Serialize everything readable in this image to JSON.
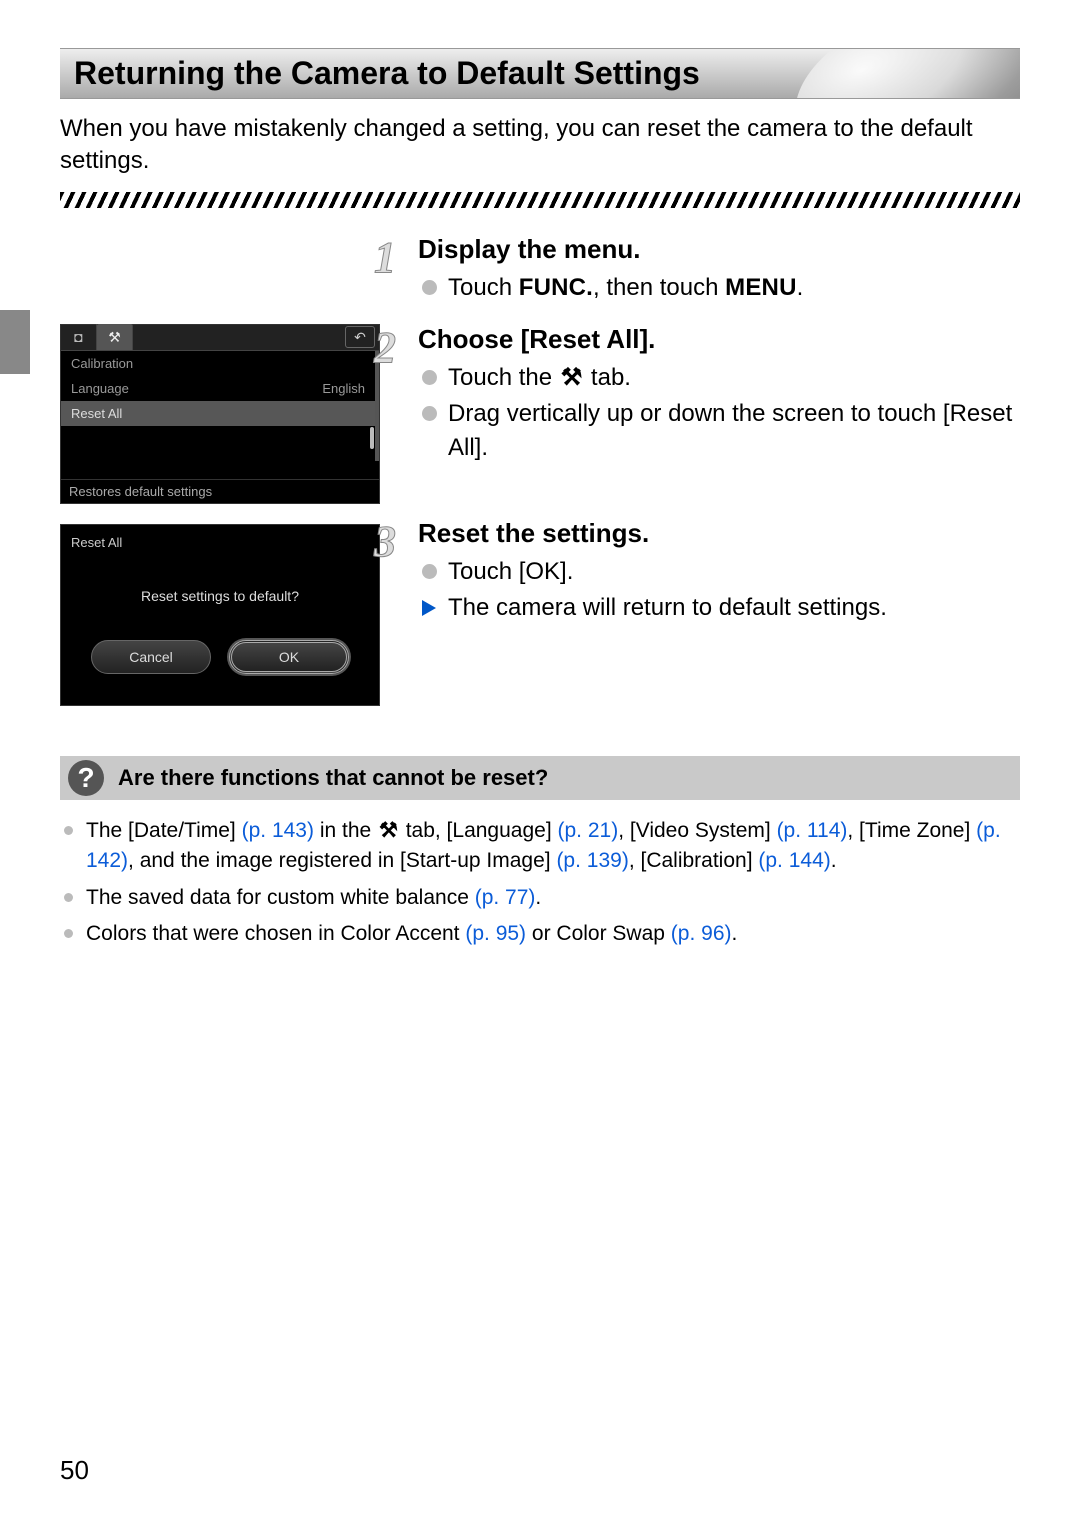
{
  "title": "Returning the Camera to Default Settings",
  "intro": "When you have mistakenly changed a setting, you can reset the camera to the default settings.",
  "steps": [
    {
      "num": "1",
      "heading": "Display the menu.",
      "lines": [
        {
          "kind": "dot",
          "text_pre": "Touch ",
          "func": "FUNC.",
          "mid": ", then touch ",
          "menu": "MENU",
          "post": "."
        }
      ]
    },
    {
      "num": "2",
      "heading": "Choose [Reset All].",
      "lines": [
        {
          "kind": "dot",
          "text_pre": "Touch the ",
          "tools_icon": "⚒",
          "post": " tab."
        },
        {
          "kind": "dot",
          "text_pre": "Drag vertically up or down the screen to touch [Reset All]."
        }
      ]
    },
    {
      "num": "3",
      "heading": "Reset the settings.",
      "lines": [
        {
          "kind": "dot",
          "text_pre": "Touch [OK]."
        },
        {
          "kind": "tri",
          "text_pre": "The camera will return to default settings."
        }
      ]
    }
  ],
  "screen1": {
    "tab_cam_icon": "◘",
    "tab_tools_icon": "⚒",
    "back_icon": "↶",
    "rows": [
      {
        "label": "Calibration",
        "value": ""
      },
      {
        "label": "Language",
        "value": "English"
      },
      {
        "label": "Reset All",
        "value": "",
        "selected": true
      }
    ],
    "footer": "Restores default settings"
  },
  "screen2": {
    "title": "Reset All",
    "message": "Reset settings to default?",
    "cancel": "Cancel",
    "ok": "OK"
  },
  "note_heading": "Are there functions that cannot be reset?",
  "notes": [
    {
      "segments": [
        {
          "t": "The [Date/Time] "
        },
        {
          "t": "(p. 143)",
          "ref": true
        },
        {
          "t": " in the "
        },
        {
          "tools": true
        },
        {
          "t": " tab, [Language] "
        },
        {
          "t": "(p. 21)",
          "ref": true
        },
        {
          "t": ", [Video System] "
        },
        {
          "t": "(p. 114)",
          "ref": true
        },
        {
          "t": ", [Time Zone] "
        },
        {
          "t": "(p. 142)",
          "ref": true
        },
        {
          "t": ", and the image registered in [Start-up Image] "
        },
        {
          "t": "(p. 139)",
          "ref": true
        },
        {
          "t": ", [Calibration] "
        },
        {
          "t": "(p. 144)",
          "ref": true
        },
        {
          "t": "."
        }
      ]
    },
    {
      "segments": [
        {
          "t": "The saved data for custom white balance "
        },
        {
          "t": "(p. 77)",
          "ref": true
        },
        {
          "t": "."
        }
      ]
    },
    {
      "segments": [
        {
          "t": "Colors that were chosen in Color Accent "
        },
        {
          "t": "(p. 95)",
          "ref": true
        },
        {
          "t": " or Color Swap "
        },
        {
          "t": "(p. 96)",
          "ref": true
        },
        {
          "t": "."
        }
      ]
    }
  ],
  "page_number": "50",
  "icons": {
    "tools_inline": "⚒"
  }
}
